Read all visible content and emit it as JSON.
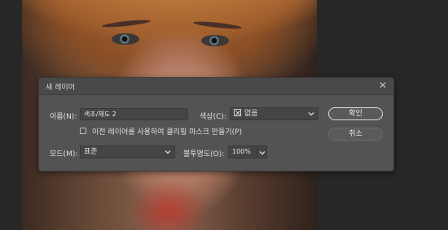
{
  "dialog": {
    "title": "새 레이어",
    "name_label": "이름(N):",
    "name_value": "색조/채도 2",
    "color_label": "색상(C):",
    "color_value": "없음",
    "clip_checkbox_label": "이전 레이어를 사용하여 클리핑 마스크 만들기(P)",
    "clip_checked": false,
    "mode_label": "모드(M):",
    "mode_value": "표준",
    "opacity_label": "불투명도(O):",
    "opacity_value": "100%",
    "ok_label": "확인",
    "cancel_label": "취소"
  },
  "icons": {
    "close": "close-icon",
    "chevron": "chevron-down-icon",
    "color_swatch": "no-color-x-icon"
  }
}
